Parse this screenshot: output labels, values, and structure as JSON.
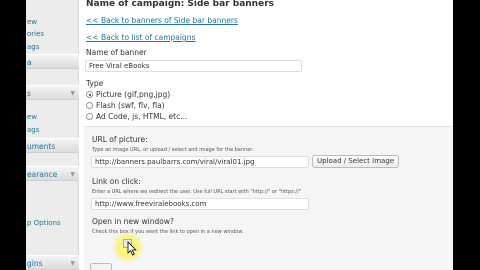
{
  "sidebar": {
    "items": [
      {
        "label": "ew",
        "kind": "link"
      },
      {
        "label": "ories",
        "kind": "link"
      },
      {
        "label": "ags",
        "kind": "link"
      },
      {
        "label": "a",
        "kind": "head"
      },
      {
        "label": "s",
        "kind": "head"
      },
      {
        "label": "ew",
        "kind": "link"
      },
      {
        "label": "ags",
        "kind": "link"
      },
      {
        "label": "uments",
        "kind": "head"
      },
      {
        "label": "earance",
        "kind": "head"
      },
      {
        "label": "p Options",
        "kind": "link"
      },
      {
        "label": "gins",
        "kind": "head"
      }
    ]
  },
  "main": {
    "title": "Name of campaign: Side bar banners",
    "back_banners_link": "<< Back to banners of Side bar banners",
    "back_list_link": "<< Back to list of campaigns",
    "name_label": "Name of banner",
    "name_value": "Free Viral eBooks",
    "type_label": "Type",
    "type_options": [
      {
        "label": "Picture (gif,png,jpg)",
        "selected": true
      },
      {
        "label": "Flash (swf, flv, fla)",
        "selected": false
      },
      {
        "label": "Ad Code, js, HTML, etc...",
        "selected": false
      }
    ],
    "url_label": "URL of picture:",
    "url_hint": "Type an image URL, or upload / select and image for the banner.",
    "url_value": "http://banners.paulbarrs.com/viral/viral01.jpg",
    "upload_button": "Upload / Select Image",
    "link_label": "Link on click:",
    "link_hint": "Enter a URL where we redirect the user. Use full URL start with \"http://\" or \"https://\"",
    "link_value": "http://www.freeviralebooks.com",
    "newwin_label": "Open in new window?",
    "newwin_hint": "Check this box if you want the link to open in a new window."
  }
}
